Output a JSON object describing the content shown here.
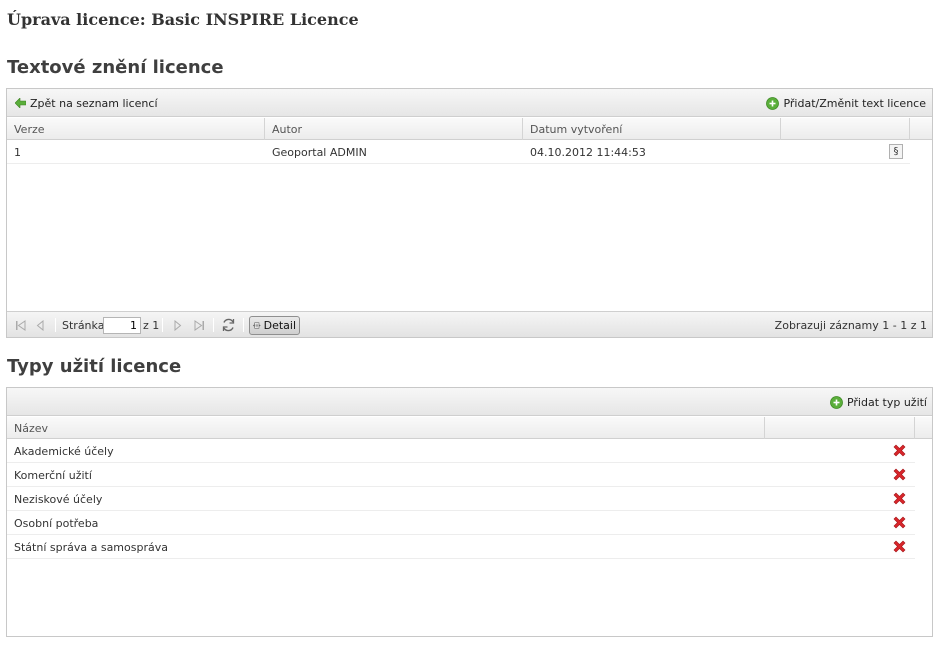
{
  "page": {
    "title": "Úprava licence: Basic INSPIRE Licence"
  },
  "text_section": {
    "title": "Textové znění licence",
    "toolbar": {
      "back_label": "Zpět na seznam licencí",
      "add_label": "Přidat/Změnit text licence"
    },
    "columns": [
      "Verze",
      "Autor",
      "Datum vytvoření",
      ""
    ],
    "rows": [
      {
        "version": "1",
        "author": "Geoportal ADMIN",
        "created": "04.10.2012 11:44:53",
        "action_icon": "§"
      }
    ],
    "pager": {
      "page_label": "Stránka",
      "page_value": "1",
      "of_label": "z 1",
      "detail_label": "Detail",
      "summary": "Zobrazuji záznamy 1 - 1 z 1"
    }
  },
  "usage_section": {
    "title": "Typy užití licence",
    "toolbar": {
      "add_label": "Přidat typ užití"
    },
    "columns": [
      "Název",
      ""
    ],
    "rows": [
      {
        "name": "Akademické účely"
      },
      {
        "name": "Komerční užití"
      },
      {
        "name": "Neziskové účely"
      },
      {
        "name": "Osobní potřeba"
      },
      {
        "name": "Státní správa a samospráva"
      }
    ]
  },
  "colors": {
    "add_icon": "#5aae3a",
    "delete_icon": "#d9262b",
    "header_bg": "#ececec"
  }
}
